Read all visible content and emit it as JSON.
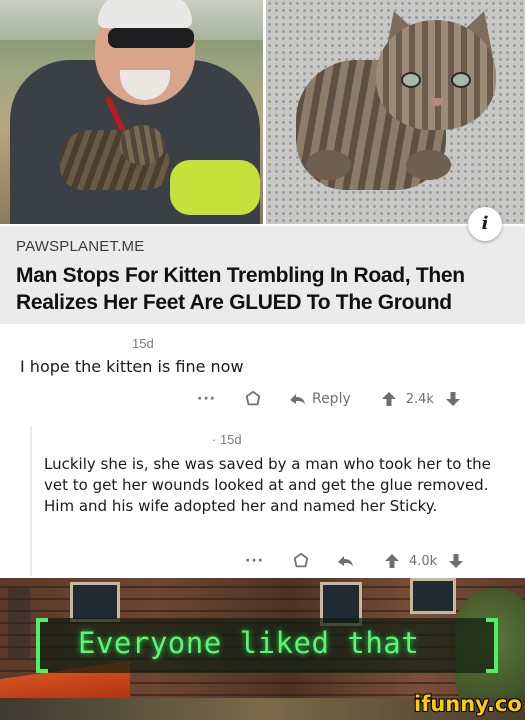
{
  "article": {
    "source": "PAWSPLANET.ME",
    "headline": "Man Stops For Kitten Trembling In Road, Then Realizes Her Feet Are GLUED To The Ground",
    "info_icon": "i"
  },
  "comments": [
    {
      "time": "15d",
      "body": "I hope the kitten is fine now",
      "more_label": "···",
      "reply_label": "Reply",
      "score": "2.4k",
      "icons": [
        "more-icon",
        "award-icon",
        "reply-icon",
        "upvote-icon",
        "downvote-icon"
      ]
    },
    {
      "time": "· 15d",
      "body": "Luckily she is, she was saved by a man who took her to the vet to get her wounds looked at and get the glue removed. Him and his wife adopted her and named her Sticky.",
      "more_label": "···",
      "score": "4.0k",
      "icons": [
        "more-icon",
        "award-icon",
        "reply-icon",
        "upvote-icon",
        "downvote-icon"
      ]
    }
  ],
  "meme": {
    "caption": "Everyone liked that",
    "caption_color": "#5cf57a"
  },
  "watermark": "ifunny.co",
  "colors": {
    "article_bg": "#ebebeb",
    "muted_text": "#6f6f6f",
    "watermark": "#ffcc00"
  }
}
